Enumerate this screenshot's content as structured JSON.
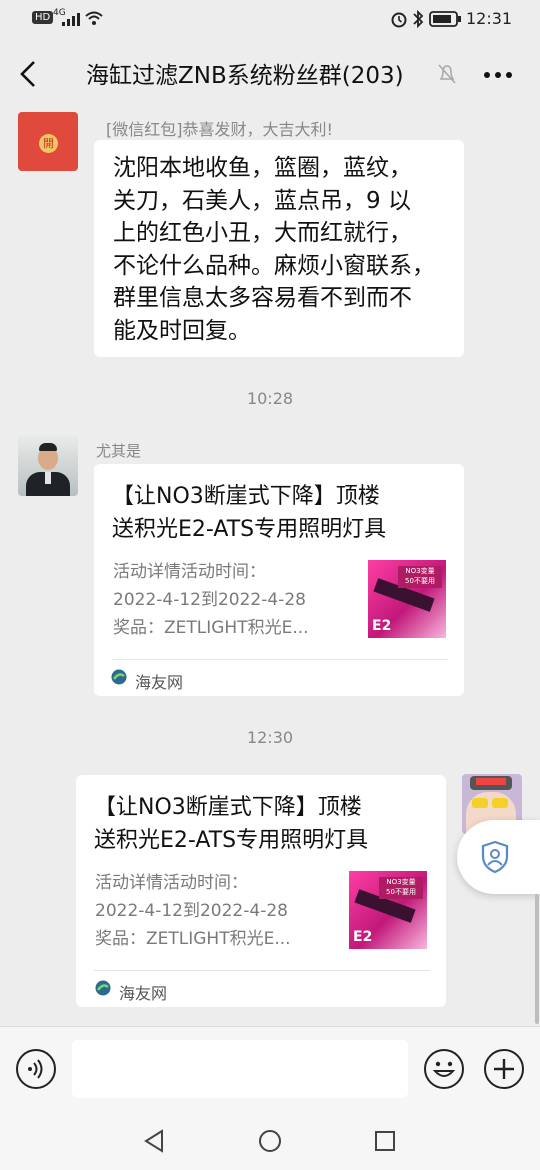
{
  "status_bar": {
    "hd_label": "HD",
    "network_label": "4G",
    "time": "12:31"
  },
  "header": {
    "back_icon": "chevron-left-icon",
    "title": "海缸过滤ZNB系统粉丝群(203)",
    "mute_icon": "bell-off-icon",
    "more_icon": "more-icon"
  },
  "messages": {
    "red_packet": {
      "label": "[微信红包]",
      "greeting": "恭喜发财，大吉大利!",
      "icon": "red-packet-icon",
      "seal_char": "開"
    },
    "text_msg": {
      "lines": [
        "沈阳本地收鱼，篮圈，蓝纹，",
        "关刀，石美人，蓝点吊，9 以",
        "上的红色小丑，大而红就行，",
        "不论什么品种。麻烦小窗联系，",
        "群里信息太多容易看不到而不",
        "能及时回复。"
      ]
    },
    "time1": "10:28",
    "card1": {
      "sender": "尤其是",
      "title_line1": "【让NO3断崖式下降】顶楼",
      "title_line2": "送积光E2-ATS专用照明灯具",
      "desc_line1": "活动详情活动时间：",
      "desc_line2": "2022-4-12到2022-4-28",
      "desc_line3": "奖品：ZETLIGHT积光E...",
      "source": "海友网",
      "thumb_text": "NO3变量\n50不要用"
    },
    "time2": "12:30",
    "card2": {
      "title_line1": "【让NO3断崖式下降】顶楼",
      "title_line2": "送积光E2-ATS专用照明灯具",
      "desc_line1": "活动详情活动时间：",
      "desc_line2": "2022-4-12到2022-4-28",
      "desc_line3": "奖品：ZETLIGHT积光E...",
      "source": "海友网",
      "thumb_text": "NO3变量\n50不要用"
    }
  },
  "input_bar": {
    "voice_icon": "voice-icon",
    "emoji_icon": "emoji-icon",
    "plus_icon": "plus-icon",
    "placeholder": ""
  },
  "nav": {
    "back_icon": "triangle-back-icon",
    "home_icon": "circle-home-icon",
    "recent_icon": "square-recent-icon"
  },
  "colors": {
    "background": "#ededed",
    "bubble": "#ffffff",
    "secondary_text": "#888888",
    "red_packet": "#e04a3c"
  }
}
